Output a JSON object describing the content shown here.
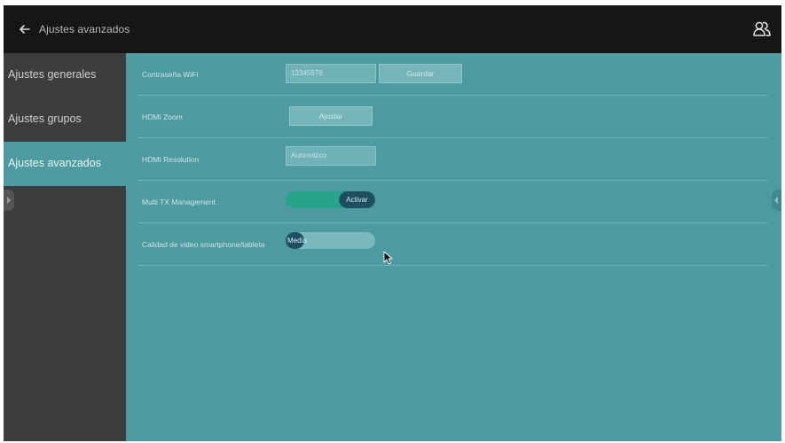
{
  "header": {
    "title": "Ajustes avanzados",
    "back_icon": "arrow-left-icon",
    "users_icon": "users-icon"
  },
  "sidebar": {
    "items": [
      {
        "label": "Ajustes generales",
        "active": false
      },
      {
        "label": "Ajustes grupos",
        "active": false
      },
      {
        "label": "Ajustes avanzados",
        "active": true
      }
    ]
  },
  "settings": {
    "wifi": {
      "label": "Contraseña WiFi",
      "value": "12345678",
      "save_label": "Guardar"
    },
    "hdmi_zoom": {
      "label": "HDMI Zoom",
      "adjust_label": "Ajustar"
    },
    "hdmi_resolution": {
      "label": "HDMI Resolution",
      "value": "Automático"
    },
    "multi_tx": {
      "label": "Multi TX Management",
      "toggle_label": "Activar"
    },
    "video_quality": {
      "label": "Calidad de video smartphone/tableta",
      "value": "Media"
    }
  },
  "colors": {
    "content_bg": "#4d9aa0",
    "topbar_bg": "#161616",
    "sidebar_bg": "#3d3d3d",
    "toggle_on": "#27a48b",
    "knob": "#1c5061"
  }
}
